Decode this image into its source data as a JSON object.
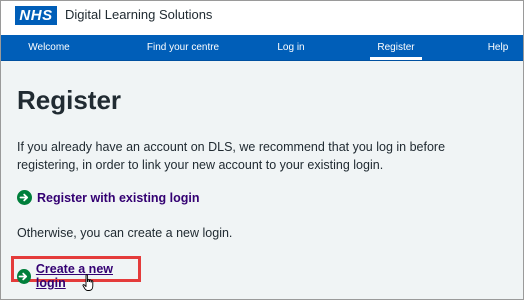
{
  "header": {
    "logo_text": "NHS",
    "service_name": "Digital Learning Solutions"
  },
  "nav": {
    "items": [
      {
        "label": "Welcome",
        "active": false
      },
      {
        "label": "Find your centre",
        "active": false
      },
      {
        "label": "Log in",
        "active": false
      },
      {
        "label": "Register",
        "active": true
      },
      {
        "label": "Help",
        "active": false
      }
    ]
  },
  "main": {
    "title": "Register",
    "intro": "If you already have an account on DLS, we recommend that you log in before registering, in order to link your new account to your existing login.",
    "existing_link": "Register with existing login",
    "otherwise": "Otherwise, you can create a new login.",
    "create_link": "Create a new login"
  },
  "colors": {
    "nhs_blue": "#005eb8",
    "link_purple": "#330072",
    "arrow_green": "#007f3b",
    "highlight_red": "#e43b3b"
  },
  "icons": {
    "arrow": "arrow-right-circle-icon",
    "cursor": "hand-pointer-icon"
  }
}
